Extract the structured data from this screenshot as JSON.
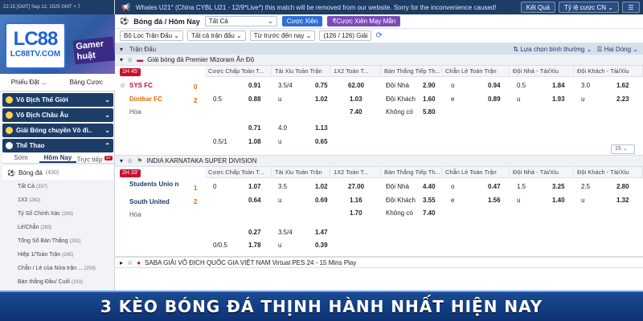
{
  "topbar": {
    "time": "22:15 [GMT] Sep 12, 2025 GMT + 7",
    "marquee": "Whales U21° (China CYBL U21 - 12/9*Live*) this match will be removed from our website. Sorry for the inconvenience caused!",
    "result_btn": "Kết Quả",
    "odds_btn": "Tỷ lệ cược CN"
  },
  "brand": {
    "logo": "LC88",
    "site": "LC88TV.COM",
    "promo": "Gamer huật"
  },
  "sidebar": {
    "tab1": "Phiếu Đặt ...",
    "tab2": "Bảng Cược",
    "sections": [
      "Vô Địch Thế Giới",
      "Vô Địch Châu Âu",
      "Giải Bóng chuyền Vô đi..",
      "Thể Thao"
    ],
    "subtabs": [
      "Sớm",
      "Hôm Nay",
      "Trực tiếp"
    ],
    "live_count": "37",
    "sport": "Bóng đá",
    "sport_count": "(430)",
    "markets": [
      {
        "label": "Tất Cả",
        "count": "(337)"
      },
      {
        "label": "1X2",
        "count": "(282)"
      },
      {
        "label": "Tỷ Số Chính Xác",
        "count": "(283)"
      },
      {
        "label": "Lẻ/Chẵn",
        "count": "(283)"
      },
      {
        "label": "Tổng Số Bàn Thắng",
        "count": "(252)"
      },
      {
        "label": "Hiệp 1/Toàn Trận",
        "count": "(245)"
      },
      {
        "label": "Chẵn / Lẻ của Nửa trận ...",
        "count": "(259)"
      },
      {
        "label": "Bàn thắng Đầu/ Cuối",
        "count": "(193)"
      }
    ]
  },
  "content": {
    "breadcrumb": "Bóng đá / Hôm Nay",
    "filter": "Tất Cả",
    "bet_button": "Cược Xiên",
    "mixed_button": "Cược Xiên Mạy Mắn",
    "filters": [
      "Bộ Lọc Trận Đấu",
      "Tất cả trận đấu",
      "Từ trước đến nay",
      "(126 / 126) Giải"
    ],
    "section_label": "Trận Đấu",
    "sort": "Lựa chọn bình thường",
    "view": "Hai Dòng",
    "columns": [
      "Cược Chấp Toàn T...",
      "Tài Xỉu Toàn Trận",
      "1X2 Toàn T...",
      "Bàn Thắng Tiếp Th...",
      "Chẵn Lẻ Toàn Trận",
      "Đội Nhà - Tài/Xỉu",
      "Đội Khách - Tài/Xỉu"
    ],
    "pager": "15",
    "leagues": [
      {
        "name": "Giải bóng đá Premier Mizoram Ấn Độ",
        "live": "1H 45'",
        "home": "SYS FC",
        "away": "Dinthar FC",
        "draw": "Hòa",
        "home_score": "0",
        "away_score": "2",
        "r1": [
          "0.91",
          "3.5/4",
          "0.75",
          "62.00",
          "Đội Nhà",
          "2.90",
          "o",
          "0.94",
          "0.5",
          "1.84",
          "3.0",
          "1.62"
        ],
        "r2": [
          "0.5",
          "0.88",
          "u",
          "1.02",
          "1.03",
          "Đội Khách",
          "1.60",
          "e",
          "0.89",
          "u",
          "1.93",
          "u",
          "2.23"
        ],
        "r3": [
          "7.40",
          "Không có",
          "5.80"
        ],
        "r4": [
          "0.71",
          "4.0",
          "1.13"
        ],
        "r5": [
          "0.5/1",
          "1.08",
          "u",
          "0.65"
        ]
      },
      {
        "name": "INDIA KARNATAKA SUPER DIVISION",
        "live": "2H 33'",
        "home": "Students Unio n",
        "away": "South United",
        "draw": "Hòa",
        "home_score": "1",
        "away_score": "2",
        "r1": [
          "0",
          "1.07",
          "3.5",
          "1.02",
          "27.00",
          "Đội Nhà",
          "4.40",
          "o",
          "0.47",
          "1.5",
          "3.25",
          "2.5",
          "2.80"
        ],
        "r2": [
          "0.64",
          "u",
          "0.69",
          "1.16",
          "Đội Khách",
          "3.55",
          "e",
          "1.56",
          "u",
          "1.40",
          "u",
          "1.32"
        ],
        "r3": [
          "1.70",
          "Không có",
          "7.40"
        ],
        "r4": [
          "0.27",
          "3.5/4",
          "1.47"
        ],
        "r5": [
          "0/0.5",
          "1.78",
          "u",
          "0.39"
        ]
      }
    ],
    "next_league": "SABA GIẢI VÔ ĐỊCH QUỐC GIA VIỆT NAM Virtual PES 24 - 15 Mins Play"
  },
  "headline": "3 KÈO BÓNG ĐÁ THỊNH HÀNH NHẤT HIỆN NAY",
  "colors": {
    "navy": "#1d3c66",
    "accent_blue": "#2f6fd6",
    "purple": "#7b4bb8",
    "live_red": "#c8102e"
  }
}
